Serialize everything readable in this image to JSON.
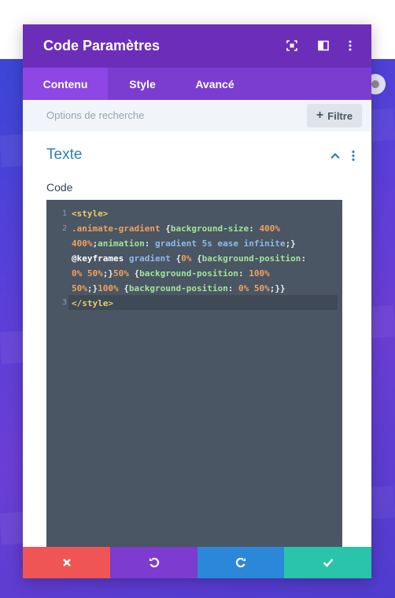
{
  "modal": {
    "title": "Code Paramètres",
    "header_icons": [
      "focus-icon",
      "split-view-icon",
      "more-vertical-icon"
    ]
  },
  "tabs": [
    {
      "label": "Contenu",
      "active": true
    },
    {
      "label": "Style",
      "active": false
    },
    {
      "label": "Avancé",
      "active": false
    }
  ],
  "search": {
    "placeholder": "Options de recherche",
    "filter_label": "Filtre"
  },
  "section": {
    "title": "Texte",
    "expanded": true
  },
  "field": {
    "label": "Code"
  },
  "editor": {
    "line_numbers": [
      "1",
      "2",
      "3"
    ],
    "lines": [
      [
        {
          "t": "<style>",
          "c": "t-tag"
        }
      ],
      [
        {
          "t": ".animate-gradient ",
          "c": "t-cls"
        },
        {
          "t": "{",
          "c": "t-plain"
        },
        {
          "t": "background-size",
          "c": "t-prop"
        },
        {
          "t": ": ",
          "c": "t-plain"
        },
        {
          "t": "400%",
          "c": "t-num"
        }
      ],
      [
        {
          "t": "400%",
          "c": "t-num"
        },
        {
          "t": ";",
          "c": "t-plain"
        },
        {
          "t": "animation",
          "c": "t-prop"
        },
        {
          "t": ": ",
          "c": "t-plain"
        },
        {
          "t": "gradient 5s ease infinite",
          "c": "t-val"
        },
        {
          "t": ";}",
          "c": "t-plain"
        }
      ],
      [
        {
          "t": "@keyframes ",
          "c": "t-kw"
        },
        {
          "t": "gradient ",
          "c": "t-val"
        },
        {
          "t": "{",
          "c": "t-plain"
        },
        {
          "t": "0% ",
          "c": "t-num"
        },
        {
          "t": "{",
          "c": "t-plain"
        },
        {
          "t": "background-position",
          "c": "t-prop"
        },
        {
          "t": ":",
          "c": "t-plain"
        }
      ],
      [
        {
          "t": "0% 50%",
          "c": "t-num"
        },
        {
          "t": ";}",
          "c": "t-plain"
        },
        {
          "t": "50% ",
          "c": "t-num"
        },
        {
          "t": "{",
          "c": "t-plain"
        },
        {
          "t": "background-position",
          "c": "t-prop"
        },
        {
          "t": ": ",
          "c": "t-plain"
        },
        {
          "t": "100%",
          "c": "t-num"
        }
      ],
      [
        {
          "t": "50%",
          "c": "t-num"
        },
        {
          "t": ";}",
          "c": "t-plain"
        },
        {
          "t": "100% ",
          "c": "t-num"
        },
        {
          "t": "{",
          "c": "t-plain"
        },
        {
          "t": "background-position",
          "c": "t-prop"
        },
        {
          "t": ": ",
          "c": "t-plain"
        },
        {
          "t": "0% 50%",
          "c": "t-num"
        },
        {
          "t": ";}}",
          "c": "t-plain"
        }
      ],
      [
        {
          "t": "</style>",
          "c": "t-tag"
        }
      ]
    ]
  },
  "footer": {
    "buttons": [
      {
        "name": "cancel-button",
        "icon": "close-icon",
        "color": "#ef5555"
      },
      {
        "name": "undo-button",
        "icon": "undo-icon",
        "color": "#7e3bd0"
      },
      {
        "name": "redo-button",
        "icon": "redo-icon",
        "color": "#2b87da"
      },
      {
        "name": "save-button",
        "icon": "check-icon",
        "color": "#29c4a9"
      }
    ]
  },
  "colors": {
    "header": "#6c2eb9",
    "tabs": "#7b3dd0",
    "active_tab": "#8c47e4",
    "section_title": "#2d82b7",
    "editor_bg": "#4a5663"
  }
}
